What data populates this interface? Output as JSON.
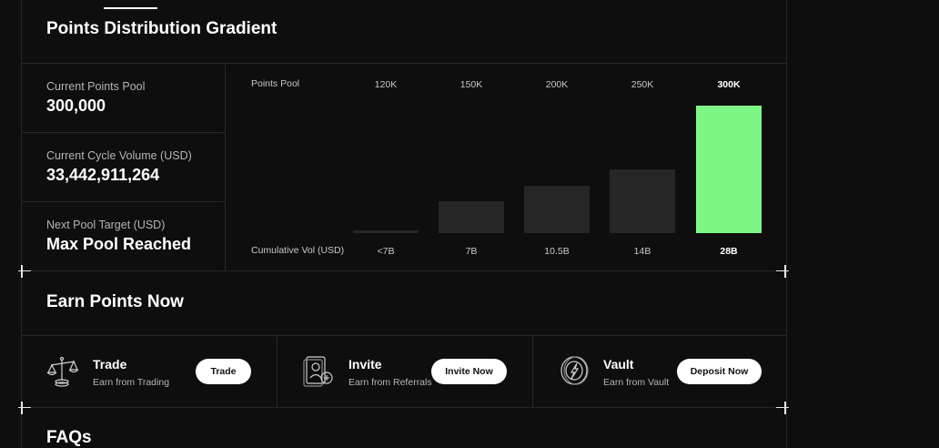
{
  "sections": {
    "gradient_title": "Points Distribution Gradient",
    "earn_title": "Earn Points Now",
    "faq_title": "FAQs"
  },
  "stats": [
    {
      "label": "Current Points Pool",
      "value": "300,000"
    },
    {
      "label": "Current Cycle Volume (USD)",
      "value": "33,442,911,264"
    },
    {
      "label": "Next Pool Target (USD)",
      "value": "Max Pool Reached"
    }
  ],
  "chart_data": {
    "type": "bar",
    "row_label_top": "Points Pool",
    "row_label_bottom": "Cumulative Vol (USD)",
    "categories": [
      "<7B",
      "7B",
      "10.5B",
      "14B",
      "28B"
    ],
    "pool_labels": [
      "120K",
      "150K",
      "200K",
      "250K",
      "300K"
    ],
    "values": [
      120000,
      150000,
      200000,
      250000,
      300000
    ],
    "active_index": 4,
    "colors": {
      "bar": "#262626",
      "active": "#7ef686"
    }
  },
  "earn": [
    {
      "title": "Trade",
      "subtitle": "Earn from Trading",
      "button": "Trade",
      "icon": "scale-icon"
    },
    {
      "title": "Invite",
      "subtitle": "Earn from Referrals",
      "button": "Invite Now",
      "icon": "referral-card-icon"
    },
    {
      "title": "Vault",
      "subtitle": "Earn from Vault",
      "button": "Deposit Now",
      "icon": "vault-coin-icon"
    }
  ]
}
